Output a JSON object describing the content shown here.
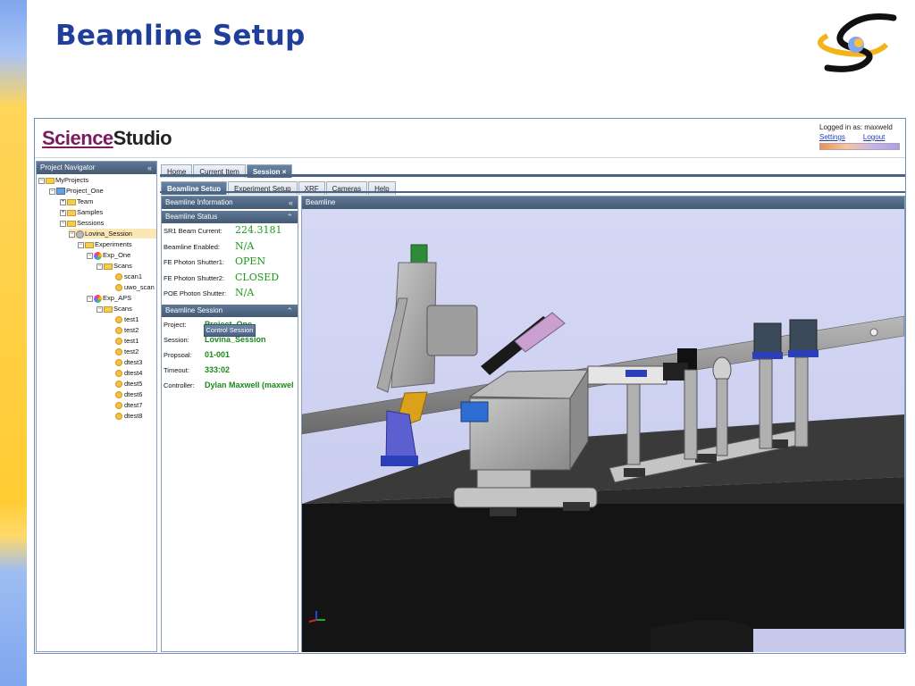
{
  "slide": {
    "title": "Beamline Setup"
  },
  "app": {
    "brand": {
      "part1": "Science",
      "part2": "Studio"
    },
    "login": {
      "text": "Logged in as: maxweld",
      "settings": "Settings",
      "logout": "Logout"
    }
  },
  "navigator": {
    "title": "Project Navigator",
    "tree": [
      {
        "label": "MyProjects",
        "icon": "folder-icon"
      },
      {
        "label": "Project_One",
        "icon": "project-icon"
      },
      {
        "label": "Team",
        "icon": "folder-icon"
      },
      {
        "label": "Samples",
        "icon": "folder-icon"
      },
      {
        "label": "Sessions",
        "icon": "folder-icon"
      },
      {
        "label": "Lovina_Session",
        "icon": "gear-icon"
      },
      {
        "label": "Experiments",
        "icon": "folder-icon"
      },
      {
        "label": "Exp_One",
        "icon": "experiment-icon"
      },
      {
        "label": "Scans",
        "icon": "folder-icon"
      },
      {
        "label": "scan1",
        "icon": "scan-icon"
      },
      {
        "label": "uwo_scan",
        "icon": "scan-icon"
      },
      {
        "label": "Exp_APS",
        "icon": "experiment-icon"
      },
      {
        "label": "Scans",
        "icon": "folder-icon"
      },
      {
        "label": "test1",
        "icon": "scan-icon"
      },
      {
        "label": "test2",
        "icon": "scan-icon"
      },
      {
        "label": "test1",
        "icon": "scan-icon"
      },
      {
        "label": "test2",
        "icon": "scan-icon"
      },
      {
        "label": "dtest3",
        "icon": "scan-icon"
      },
      {
        "label": "dtest4",
        "icon": "scan-icon"
      },
      {
        "label": "dtest5",
        "icon": "scan-icon"
      },
      {
        "label": "dtest6",
        "icon": "scan-icon"
      },
      {
        "label": "dtest7",
        "icon": "scan-icon"
      },
      {
        "label": "dtest8",
        "icon": "scan-icon"
      }
    ]
  },
  "tabs": {
    "main": [
      "Home",
      "Current Item",
      "Session"
    ],
    "sub": [
      "Beamline Setup",
      "Experiment Setup",
      "XRF",
      "Cameras",
      "Help"
    ],
    "close_glyph": "×"
  },
  "beamline_info": {
    "title": "Beamline Information",
    "status_title": "Beamline Status",
    "status": [
      {
        "label": "SR1 Beam Current:",
        "value": "224.3181"
      },
      {
        "label": "Beamline Enabled:",
        "value": "N/A"
      },
      {
        "label": "FE Photon Shutter1:",
        "value": "OPEN"
      },
      {
        "label": "FE Photon Shutter2:",
        "value": "CLOSED"
      },
      {
        "label": "POE Photon Shutter:",
        "value": "N/A"
      }
    ],
    "session_title": "Beamline Session",
    "session": [
      {
        "label": "Project:",
        "value": "Project_One"
      },
      {
        "label": "Session:",
        "value": "Lovina_Session"
      },
      {
        "label": "Propsoal:",
        "value": "01-001"
      },
      {
        "label": "Timeout:",
        "value": "333:02"
      },
      {
        "label": "Controller:",
        "value": "Dylan Maxwell (maxweld)"
      }
    ],
    "control_button": "Control Session"
  },
  "viewer": {
    "title": "Beamline"
  },
  "colors": {
    "header_bar": "#4b6484",
    "value_green": "#1a9a1a",
    "title_blue": "#1f3f9a",
    "brand_purple": "#7a1c5c"
  }
}
